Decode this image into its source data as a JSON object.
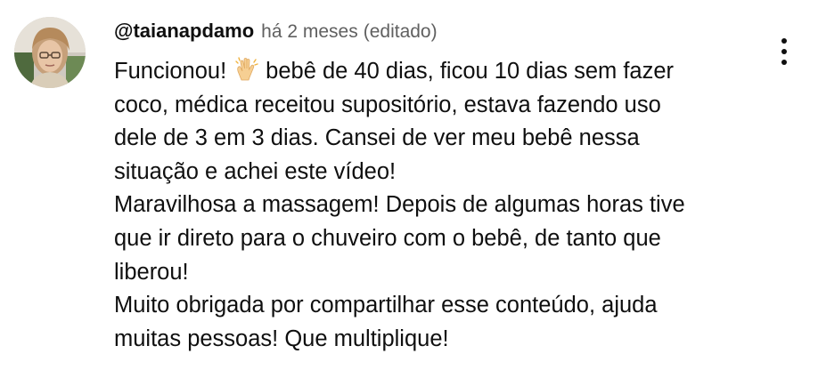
{
  "comment": {
    "author": "@taianapdamo",
    "timestamp": "há 2 meses",
    "edited_label": "(editado)",
    "avatar_icon": "user-avatar-photo",
    "emoji_icon": "raising-hands-emoji",
    "text_lines": {
      "l1_before_emoji": "Funcionou!",
      "l1_after_emoji": "bebê de 40 dias, ficou 10 dias sem fazer",
      "l2": "coco, médica receitou supositório, estava fazendo uso",
      "l3": "dele de 3 em 3 dias. Cansei de ver meu bebê nessa",
      "l4": "situação e achei este vídeo!",
      "l5": "Maravilhosa a massagem! Depois de algumas horas tive",
      "l6": "que ir direto para o chuveiro com o bebê, de tanto que",
      "l7": "liberou!",
      "l8": "Muito obrigada por compartilhar esse conteúdo, ajuda",
      "l9": "muitas pessoas! Que multiplique!"
    },
    "menu_icon": "more-vertical-icon"
  },
  "colors": {
    "text_primary": "#0f0f0f",
    "text_secondary": "#606060",
    "background": "#ffffff"
  }
}
